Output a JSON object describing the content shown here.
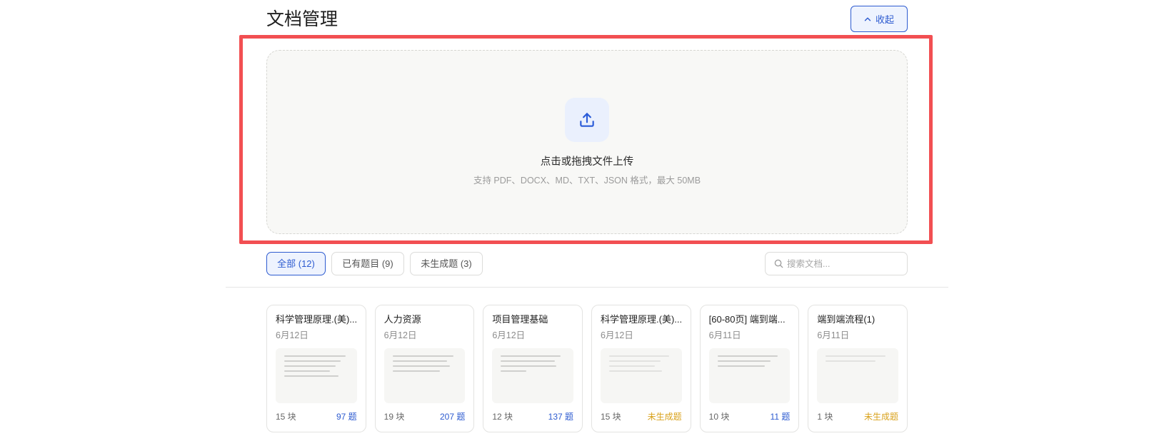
{
  "header": {
    "title": "文档管理",
    "collapse_button": {
      "label": "收起",
      "icon": "chevron-up-icon"
    }
  },
  "upload": {
    "icon": "upload-icon",
    "title": "点击或拖拽文件上传",
    "hint": "支持 PDF、DOCX、MD、TXT、JSON 格式，最大 50MB"
  },
  "filters": {
    "tabs": [
      {
        "label": "全部 (12)",
        "active": true
      },
      {
        "label": "已有题目 (9)",
        "active": false
      },
      {
        "label": "未生成题 (3)",
        "active": false
      }
    ],
    "search": {
      "icon": "search-icon",
      "placeholder": "搜索文档...",
      "value": ""
    }
  },
  "cards": [
    {
      "title": "科学管理原理.(美)...",
      "date": "6月12日",
      "chunks": "15 块",
      "questions": "97 题",
      "has_questions": true
    },
    {
      "title": "人力资源",
      "date": "6月12日",
      "chunks": "19 块",
      "questions": "207 题",
      "has_questions": true
    },
    {
      "title": "项目管理基础",
      "date": "6月12日",
      "chunks": "12 块",
      "questions": "137 题",
      "has_questions": true
    },
    {
      "title": "科学管理原理.(美)...",
      "date": "6月12日",
      "chunks": "15 块",
      "questions": "未生成题",
      "has_questions": false
    },
    {
      "title": "[60-80页] 端到端...",
      "date": "6月11日",
      "chunks": "10 块",
      "questions": "11 题",
      "has_questions": true
    },
    {
      "title": "端到端流程(1)",
      "date": "6月11日",
      "chunks": "1 块",
      "questions": "未生成题",
      "has_questions": false
    }
  ],
  "colors": {
    "accent": "#2d5bd0",
    "accentSoft": "#eef3fe",
    "pending": "#d9a21c",
    "highlight": "#f24f52"
  }
}
